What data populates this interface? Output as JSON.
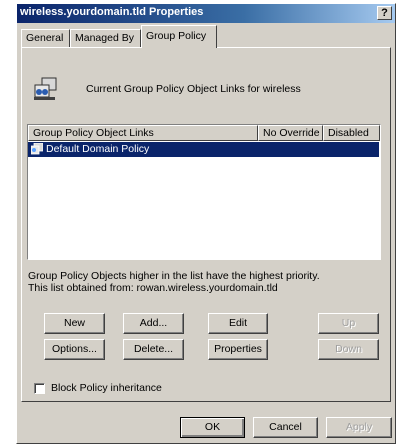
{
  "window": {
    "title": "wireless.yourdomain.tld Properties",
    "help_label": "?"
  },
  "tabs": [
    {
      "label": "General",
      "active": false
    },
    {
      "label": "Managed By",
      "active": false
    },
    {
      "label": "Group Policy",
      "active": true
    }
  ],
  "header": {
    "icon": "group-policy-icon",
    "text": "Current Group Policy Object Links for wireless"
  },
  "list": {
    "columns": [
      "Group Policy Object Links",
      "No Override",
      "Disabled"
    ],
    "rows": [
      {
        "name": "Default Domain Policy",
        "no_override": "",
        "disabled": "",
        "selected": true,
        "icon": "gpo-icon"
      }
    ]
  },
  "info": {
    "line1": "Group Policy Objects higher in the list have the highest priority.",
    "line2": "This list obtained from: rowan.wireless.yourdomain.tld"
  },
  "buttons": {
    "new": "New",
    "add": "Add...",
    "edit": "Edit",
    "up": "Up",
    "options": "Options...",
    "delete": "Delete...",
    "properties": "Properties",
    "down": "Down"
  },
  "block_inheritance": {
    "label": "Block Policy inheritance",
    "checked": false
  },
  "dialog_buttons": {
    "ok": "OK",
    "cancel": "Cancel",
    "apply": "Apply"
  }
}
